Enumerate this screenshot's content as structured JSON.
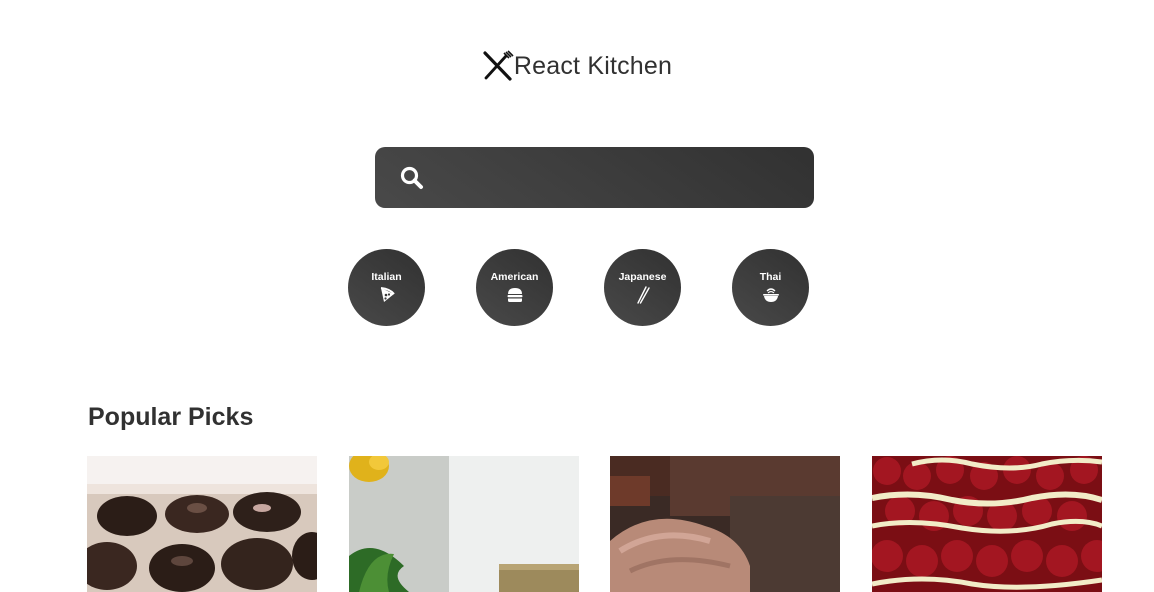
{
  "app": {
    "title": "React Kitchen"
  },
  "search": {
    "placeholder": "",
    "value": ""
  },
  "cuisines": [
    {
      "label": "Italian",
      "icon": "pizza-icon"
    },
    {
      "label": "American",
      "icon": "burger-icon"
    },
    {
      "label": "Japanese",
      "icon": "chopsticks-icon"
    },
    {
      "label": "Thai",
      "icon": "noodle-bowl-icon"
    }
  ],
  "popular": {
    "title": "Popular Picks",
    "cards": [
      {
        "image": "chocolate-cookies-photo"
      },
      {
        "image": "greens-and-flower-photo"
      },
      {
        "image": "chocolate-cake-slice-photo"
      },
      {
        "image": "raspberry-tart-photo"
      }
    ]
  },
  "colors": {
    "accent_dark": "#313131",
    "accent_light": "#494949",
    "text": "#313131"
  }
}
